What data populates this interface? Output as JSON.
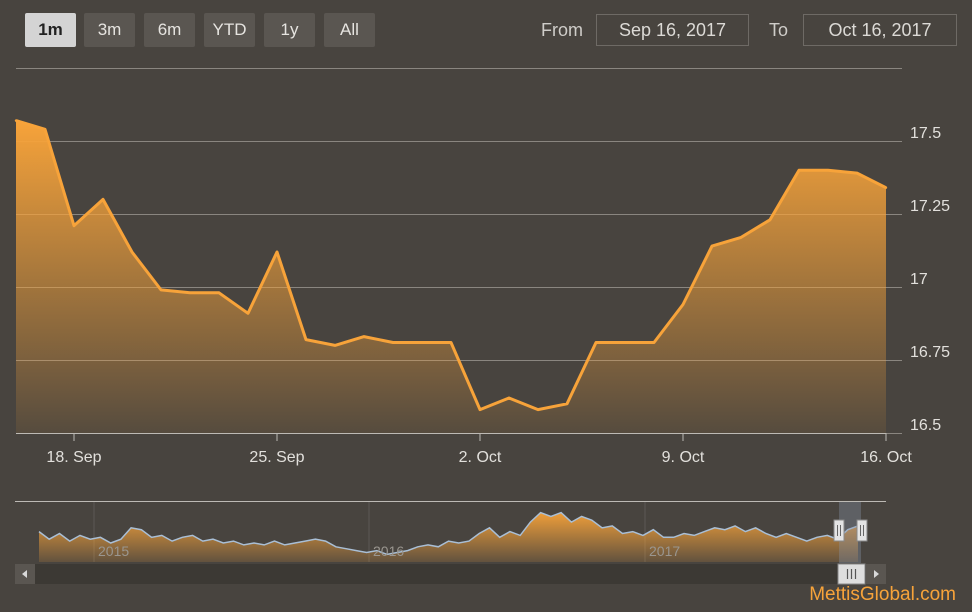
{
  "range_selector": {
    "buttons": [
      "1m",
      "3m",
      "6m",
      "YTD",
      "1y",
      "All"
    ],
    "active": "1m"
  },
  "date_range": {
    "from_label": "From",
    "from_value": "Sep 16, 2017",
    "to_label": "To",
    "to_value": "Oct 16, 2017"
  },
  "colors": {
    "line": "#f7a33a",
    "grid": "#8a8680",
    "navigator_line": "#a9bfd6"
  },
  "chart_data": {
    "type": "area",
    "x_axis": {
      "tick_labels": [
        "18. Sep",
        "25. Sep",
        "2. Oct",
        "9. Oct",
        "16. Oct"
      ],
      "tick_days": [
        2,
        9,
        16,
        23,
        30
      ]
    },
    "y_axis": {
      "tick_labels": [
        "17.5",
        "17.25",
        "17",
        "16.75",
        "16.5"
      ],
      "tick_values": [
        17.5,
        17.25,
        17,
        16.75,
        16.5
      ],
      "range": [
        16.5,
        17.75
      ]
    },
    "grid": true,
    "series": [
      {
        "points": [
          [
            0,
            17.57
          ],
          [
            1,
            17.54
          ],
          [
            2,
            17.21
          ],
          [
            3,
            17.3
          ],
          [
            4,
            17.12
          ],
          [
            5,
            16.99
          ],
          [
            6,
            16.98
          ],
          [
            7,
            16.98
          ],
          [
            8,
            16.91
          ],
          [
            9,
            17.12
          ],
          [
            10,
            16.82
          ],
          [
            11,
            16.8
          ],
          [
            12,
            16.83
          ],
          [
            13,
            16.81
          ],
          [
            14,
            16.81
          ],
          [
            15,
            16.81
          ],
          [
            16,
            16.58
          ],
          [
            17,
            16.62
          ],
          [
            18,
            16.58
          ],
          [
            19,
            16.6
          ],
          [
            20,
            16.81
          ],
          [
            21,
            16.81
          ],
          [
            22,
            16.81
          ],
          [
            23,
            16.94
          ],
          [
            24,
            17.14
          ],
          [
            25,
            17.17
          ],
          [
            26,
            17.23
          ],
          [
            27,
            17.4
          ],
          [
            28,
            17.4
          ],
          [
            29,
            17.39
          ],
          [
            30,
            17.34
          ]
        ]
      }
    ],
    "navigator": {
      "year_labels": [
        "2015",
        "2016",
        "2017"
      ],
      "values": [
        17.2,
        17.0,
        17.15,
        16.95,
        17.1,
        17.0,
        17.05,
        16.9,
        17.0,
        17.3,
        17.25,
        17.05,
        17.1,
        16.95,
        17.05,
        17.1,
        16.95,
        17.0,
        16.9,
        16.95,
        16.85,
        16.9,
        16.85,
        16.95,
        16.85,
        16.9,
        16.95,
        17.0,
        16.95,
        16.8,
        16.75,
        16.7,
        16.65,
        16.7,
        16.6,
        16.65,
        16.7,
        16.8,
        16.85,
        16.8,
        16.95,
        16.9,
        16.95,
        17.15,
        17.3,
        17.05,
        17.2,
        17.1,
        17.45,
        17.7,
        17.6,
        17.7,
        17.45,
        17.6,
        17.5,
        17.3,
        17.35,
        17.15,
        17.2,
        17.1,
        17.25,
        17.05,
        17.05,
        17.15,
        17.1,
        17.2,
        17.3,
        17.25,
        17.35,
        17.2,
        17.3,
        17.15,
        17.05,
        17.15,
        17.05,
        16.95,
        17.05,
        17.1,
        17.0,
        17.25,
        17.35
      ]
    }
  },
  "watermark": "MettisGlobal.com"
}
